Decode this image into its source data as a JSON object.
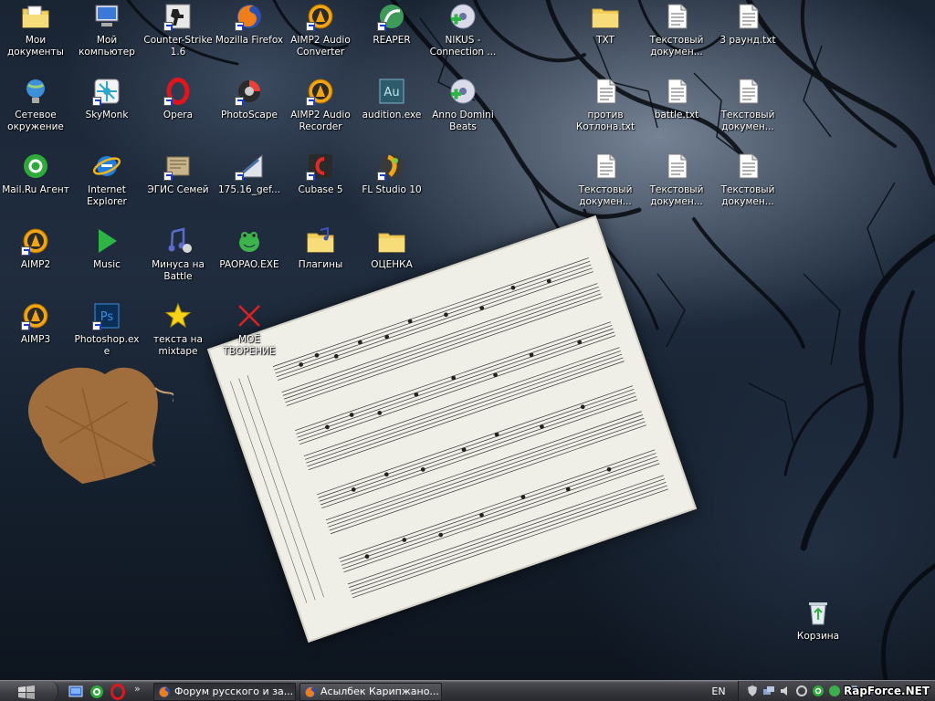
{
  "desktop": {
    "icons": [
      {
        "label": "Мои документы"
      },
      {
        "label": "Мой компьютер"
      },
      {
        "label": "Counter-Strike 1.6"
      },
      {
        "label": "Mozilla Firefox"
      },
      {
        "label": "AIMP2 Audio Converter"
      },
      {
        "label": "REAPER"
      },
      {
        "label": "NIKUS - Connection ..."
      },
      {
        "label": "TXT"
      },
      {
        "label": "Текстовый докумен..."
      },
      {
        "label": "3 раунд.txt"
      },
      {
        "label": "Сетевое окружение"
      },
      {
        "label": "SkyMonk"
      },
      {
        "label": "Opera"
      },
      {
        "label": "PhotoScape"
      },
      {
        "label": "AIMP2 Audio Recorder"
      },
      {
        "label": "audition.exe"
      },
      {
        "label": "Anno Domini Beats"
      },
      {
        "label": "против Котлона.txt"
      },
      {
        "label": "battle.txt"
      },
      {
        "label": "Текстовый докумен..."
      },
      {
        "label": "Mail.Ru Агент"
      },
      {
        "label": "Internet Explorer"
      },
      {
        "label": "ЭГИС Семей"
      },
      {
        "label": "175.16_gef..."
      },
      {
        "label": "Cubase 5"
      },
      {
        "label": "FL Studio 10"
      },
      {
        "label": "Текстовый докумен..."
      },
      {
        "label": "Текстовый докумен..."
      },
      {
        "label": "Текстовый докумен..."
      },
      {
        "label": "AIMP2"
      },
      {
        "label": "Music"
      },
      {
        "label": "Минуса на Battle"
      },
      {
        "label": "PAOPAO.EXE"
      },
      {
        "label": "Плагины"
      },
      {
        "label": "ОЦЕНКА"
      },
      {
        "label": "AIMP3"
      },
      {
        "label": "Photoshop.exe"
      },
      {
        "label": "текста на mixtape"
      },
      {
        "label": "МОЁ ТВОРЕНИЕ"
      },
      {
        "label": "Корзина"
      }
    ]
  },
  "taskbar": {
    "tasks": [
      {
        "label": "Форум русского и за..."
      },
      {
        "label": "Асылбек Карипжано..."
      }
    ],
    "quicklaunch_more": "»",
    "language": "EN"
  },
  "watermark": "RapForce.NET",
  "colors": {
    "taskbar": "#3a3b40",
    "icon_label": "#ffffff",
    "wallpaper": "#1a2534"
  }
}
